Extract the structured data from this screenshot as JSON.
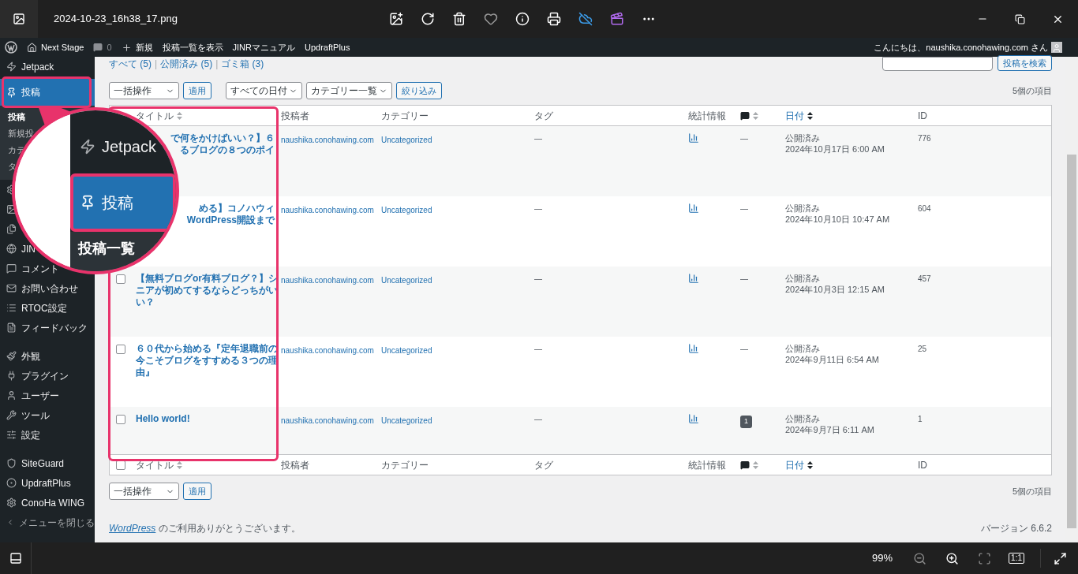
{
  "viewer": {
    "file_name": "2024-10-23_16h38_17.png",
    "zoom": "99%",
    "actual_size": "1:1"
  },
  "admin_bar": {
    "site": "Next Stage",
    "comments": "0",
    "new": "新規",
    "links": [
      "投稿一覧を表示",
      "JINRマニュアル",
      "UpdraftPlus"
    ],
    "greeting": "こんにちは、naushika.conohawing.com さん"
  },
  "sidebar": {
    "items": [
      {
        "label": "Jetpack",
        "selected": false
      },
      {
        "label": "投稿",
        "selected": true,
        "submenu": [
          {
            "label": "投稿",
            "selected": true
          },
          {
            "label": "新規投",
            "selected": false
          },
          {
            "label": "カテ",
            "selected": false
          },
          {
            "label": "タ",
            "selected": false
          }
        ]
      },
      {
        "selected": false
      },
      {
        "selected": false
      },
      {
        "selected": false
      },
      {
        "label": "JIN",
        "selected": false
      },
      {
        "label": "コメント",
        "selected": false
      },
      {
        "label": "お問い合わせ",
        "selected": false
      },
      {
        "label": "RTOC設定",
        "selected": false
      },
      {
        "label": "フィードバック",
        "selected": false
      },
      {
        "label": "外観",
        "selected": false
      },
      {
        "label": "プラグイン",
        "selected": false
      },
      {
        "label": "ユーザー",
        "selected": false
      },
      {
        "label": "ツール",
        "selected": false
      },
      {
        "label": "設定",
        "selected": false
      },
      {
        "label": "SiteGuard",
        "selected": false
      },
      {
        "label": "UpdraftPlus",
        "selected": false
      },
      {
        "label": "ConoHa WING",
        "selected": false
      },
      {
        "label": "メニューを閉じる",
        "selected": false
      }
    ]
  },
  "magnifier": {
    "items": [
      {
        "label": "Jetpack",
        "kind": "menu",
        "selected": false
      },
      {
        "label": "投稿",
        "kind": "menu",
        "selected": true
      },
      {
        "label": "投稿一覧",
        "kind": "submenu",
        "selected": true
      }
    ]
  },
  "views": {
    "separator": "|",
    "items": [
      "すべて (5)",
      "公開済み (5)",
      "ゴミ箱 (3)"
    ]
  },
  "search_button": "投稿を検索",
  "filters": {
    "bulk_action": "一括操作",
    "apply": "適用",
    "date": "すべての日付",
    "category": "カテゴリー一覧",
    "filter": "絞り込み",
    "count": "5個の項目"
  },
  "table": {
    "header": [
      {
        "kind": "text",
        "label": "タイトル",
        "sorted": false
      },
      {
        "kind": "text",
        "label": "投稿者"
      },
      {
        "kind": "text",
        "label": "カテゴリー"
      },
      {
        "kind": "text",
        "label": "タグ"
      },
      {
        "kind": "text",
        "label": "統計情報"
      },
      {
        "kind": "comment",
        "sorted": false
      },
      {
        "kind": "text",
        "label": "日付",
        "sorted": true
      },
      {
        "kind": "text",
        "label": "ID"
      }
    ],
    "rows": [
      {
        "title_lines": [
          "で何をかけばいい？】６",
          "るブログの８つのポイ"
        ],
        "author": "naushika.conohawing.com",
        "category": "Uncategorized",
        "tags": "—",
        "comments": {
          "kind": "none",
          "text": "—"
        },
        "status": "公開済み",
        "date": "2024年10月17日 6:00 AM",
        "id": "776"
      },
      {
        "title_lines": [
          "める】コノハウィ",
          "WordPress開設まで"
        ],
        "author": "naushika.conohawing.com",
        "category": "Uncategorized",
        "tags": "—",
        "comments": {
          "kind": "none",
          "text": "—"
        },
        "status": "公開済み",
        "date": "2024年10月10日 10:47 AM",
        "id": "604"
      },
      {
        "checked": false,
        "title_lines": [
          "【無料ブログor有料ブログ？】シ",
          "ニアが初めてするならどっちがい",
          "い？"
        ],
        "author": "naushika.conohawing.com",
        "category": "Uncategorized",
        "tags": "—",
        "comments": {
          "kind": "none",
          "text": "—"
        },
        "status": "公開済み",
        "date": "2024年10月3日 12:15 AM",
        "id": "457"
      },
      {
        "checked": false,
        "title_lines": [
          "６０代から始める『定年退職前の",
          "今こそブログをすすめる３つの理",
          "由』"
        ],
        "author": "naushika.conohawing.com",
        "category": "Uncategorized",
        "tags": "—",
        "comments": {
          "kind": "none",
          "text": "—"
        },
        "status": "公開済み",
        "date": "2024年9月11日 6:54 AM",
        "id": "25"
      },
      {
        "checked": false,
        "title_lines": [
          "Hello world!"
        ],
        "author": "naushika.conohawing.com",
        "category": "Uncategorized",
        "tags": "—",
        "comments": {
          "kind": "badge",
          "text": "1"
        },
        "status": "公開済み",
        "date": "2024年9月7日 6:11 AM",
        "id": "1"
      }
    ],
    "footer": [
      {
        "kind": "checkbox",
        "checked": false
      },
      {
        "kind": "text",
        "label": "タイトル",
        "sorted": false
      },
      {
        "kind": "text",
        "label": "投稿者"
      },
      {
        "kind": "text",
        "label": "カテゴリー"
      },
      {
        "kind": "text",
        "label": "タグ"
      },
      {
        "kind": "text",
        "label": "統計情報"
      },
      {
        "kind": "comment",
        "sorted": false
      },
      {
        "kind": "text",
        "label": "日付",
        "sorted": true
      },
      {
        "kind": "text",
        "label": "ID"
      }
    ]
  },
  "bottom": {
    "bulk_action": "一括操作",
    "apply": "適用",
    "count": "5個の項目"
  },
  "page_footer": {
    "link": "WordPress",
    "text": "のご利用ありがとうございます。",
    "version": "バージョン 6.6.2"
  }
}
